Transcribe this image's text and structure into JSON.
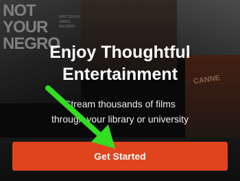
{
  "background": {
    "poster_left": {
      "title_lines": [
        "NOT",
        "YOUR",
        "NEGRO"
      ],
      "credit_lines": [
        "WRITTEN BY",
        "JAMES BALDWIN"
      ]
    },
    "poster_right": {
      "stamp": "CANNE"
    }
  },
  "headline_lines": [
    "Enjoy Thoughtful",
    "Entertainment"
  ],
  "subline_lines": [
    "Stream thousands of films",
    "through your library or university"
  ],
  "cta": {
    "label": "Get Started"
  },
  "colors": {
    "accent": "#e0441d",
    "annotation_arrow": "#33dd22"
  }
}
